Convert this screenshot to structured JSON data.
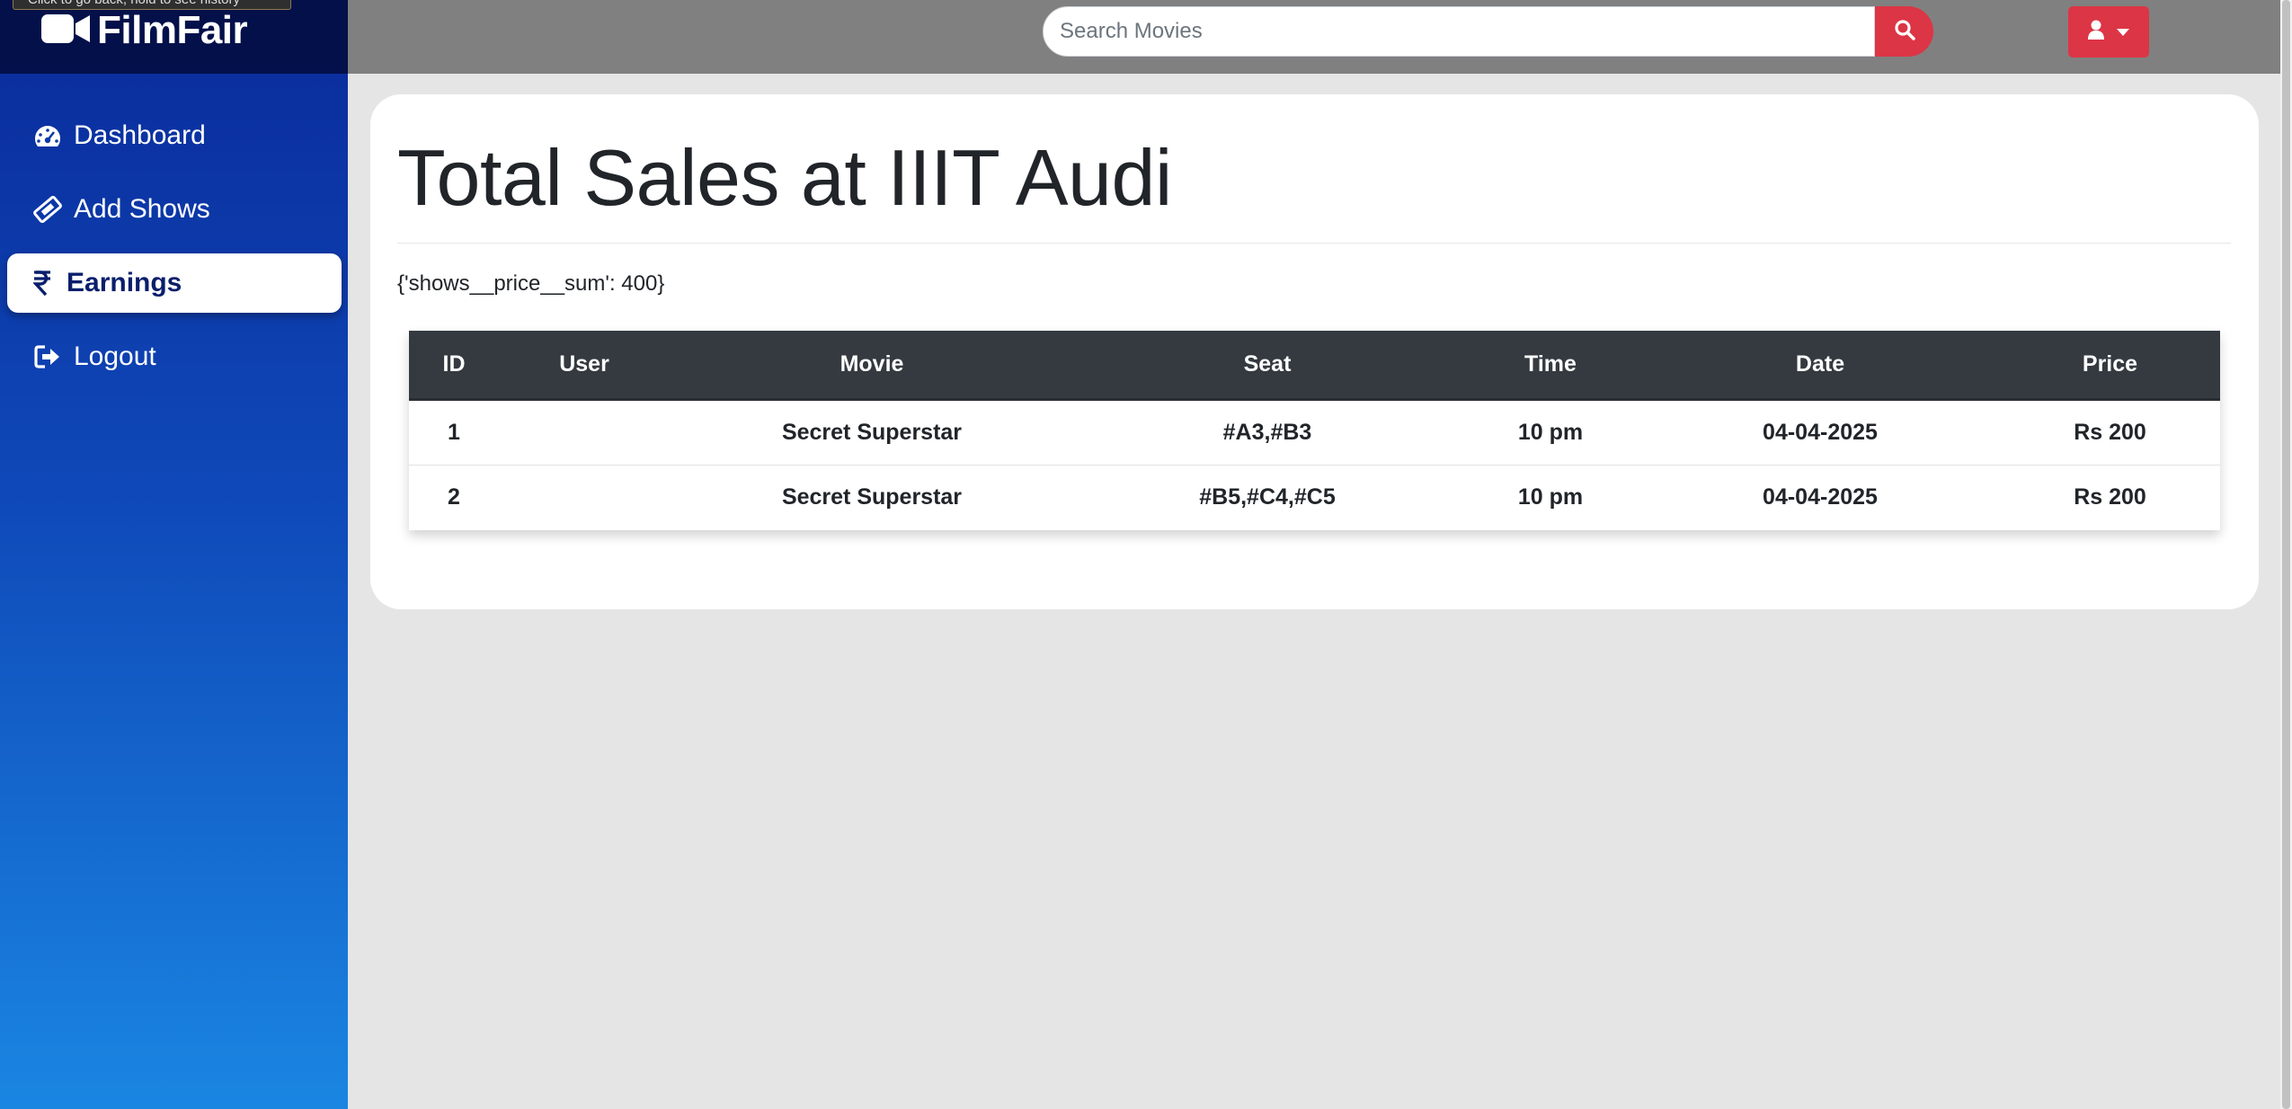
{
  "tooltip": {
    "text": "Click to go back, hold to see history"
  },
  "brand": {
    "name": "FilmFair",
    "icon": "video-camera-icon"
  },
  "sidebar": {
    "items": [
      {
        "label": "Dashboard",
        "icon": "tachometer-icon",
        "active": false
      },
      {
        "label": "Add Shows",
        "icon": "ticket-icon",
        "active": false
      },
      {
        "label": "Earnings",
        "icon": "rupee-icon",
        "active": true
      },
      {
        "label": "Logout",
        "icon": "sign-out-icon",
        "active": false
      }
    ]
  },
  "search": {
    "placeholder": "Search Movies",
    "value": "",
    "button_icon": "search-icon"
  },
  "user_menu": {
    "icon": "user-icon"
  },
  "main": {
    "title": "Total Sales at IIIT Audi",
    "sum_text": "{'shows__price__sum': 400}"
  },
  "table": {
    "headers": [
      "ID",
      "User",
      "Movie",
      "Seat",
      "Time",
      "Date",
      "Price"
    ],
    "rows": [
      [
        "1",
        "",
        "Secret Superstar",
        "#A3,#B3",
        "10 pm",
        "04-04-2025",
        "Rs 200"
      ],
      [
        "2",
        "",
        "Secret Superstar",
        "#B5,#C4,#C5",
        "10 pm",
        "04-04-2025",
        "Rs 200"
      ]
    ]
  },
  "colors": {
    "sidebar_top": "#0a2a9a",
    "sidebar_bottom": "#1a86e2",
    "brand_bg": "#03104a",
    "accent_red": "#dc3545",
    "topbar": "#808080",
    "table_header": "#343a40",
    "page_bg": "#e5e5e5"
  }
}
